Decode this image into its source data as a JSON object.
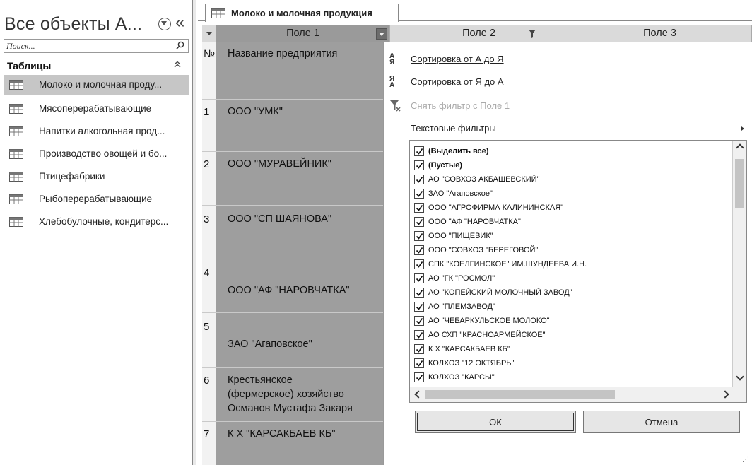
{
  "nav": {
    "title": "Все объекты А...",
    "collapse_glyph": "«",
    "search_placeholder": "Поиск...",
    "group_label": "Таблицы",
    "items": [
      {
        "label": "Молоко и молочная проду..."
      },
      {
        "label": "Мясоперерабатывающие"
      },
      {
        "label": "Напитки алкогольная прод..."
      },
      {
        "label": "Производство овощей и бо..."
      },
      {
        "label": "Птицефабрики"
      },
      {
        "label": "Рыбоперерабатывающие"
      },
      {
        "label": "Хлебобулочные, кондитерс..."
      }
    ]
  },
  "tab": {
    "label": "Молоко и молочная продукция"
  },
  "grid": {
    "headers": [
      "Поле 1",
      "Поле 2",
      "Поле 3"
    ],
    "rows": [
      {
        "num": "№",
        "name": "Название предприятия"
      },
      {
        "num": "1",
        "name": "ООО \"УМК\""
      },
      {
        "num": "2",
        "name": "ООО \"МУРАВЕЙНИК\""
      },
      {
        "num": "3",
        "name": "ООО \"СП ШАЯНОВА\""
      },
      {
        "num": "4",
        "name": "ООО \"АФ \"НАРОВЧАТКА\""
      },
      {
        "num": "5",
        "name": "ЗАО \"Агаповское\""
      },
      {
        "num": "6",
        "name": "Крестьянское\n(фермерское) хозяйство\nОсманов Мустафа Закаря"
      },
      {
        "num": "7",
        "name": "К Х \"КАРСАКБАЕВ КБ\""
      }
    ]
  },
  "filter_menu": {
    "sort_asc_icon": "А\nЯ",
    "sort_asc": "Сортировка от А до Я",
    "sort_desc_icon": "Я\nА",
    "sort_desc": "Сортировка от Я до А",
    "clear_filter": "Снять фильтр с Поле 1",
    "text_filters": "Текстовые фильтры",
    "values": [
      "(Выделить все)",
      "(Пустые)",
      "АО \"СОВХОЗ АКБАШЕВСКИЙ\"",
      "ЗАО \"Агаповское\"",
      "ООО \"АГРОФИРМА КАЛИНИНСКАЯ\"",
      "ООО \"АФ \"НАРОВЧАТКА\"",
      "ООО \"ПИЩЕВИК\"",
      "ООО \"СОВХОЗ \"БЕРЕГОВОЙ\"",
      "СПК \"КОЕЛГИНСКОЕ\" ИМ.ШУНДЕЕВА И.Н.",
      "АО \"ГК \"РОСМОЛ\"",
      "АО \"КОПЕЙСКИЙ МОЛОЧНЫЙ ЗАВОД\"",
      "АО \"ПЛЕМЗАВОД\"",
      "АО \"ЧЕБАРКУЛЬСКОЕ МОЛОКО\"",
      "АО СХП \"КРАСНОАРМЕЙСКОЕ\"",
      "К Х \"КАРСАКБАЕВ КБ\"",
      "КОЛХОЗ \"12 ОКТЯБРЬ\"",
      "КОЛХОЗ \"КАРСЫ\""
    ],
    "ok_label": "ОК",
    "cancel_label": "Отмена"
  }
}
